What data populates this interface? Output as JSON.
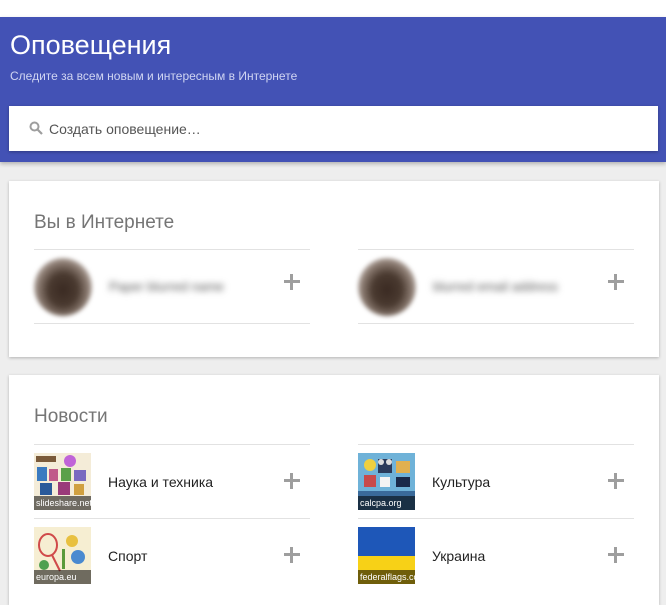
{
  "header": {
    "title": "Оповещения",
    "subtitle": "Следите за всем новым и интересным в Интернете",
    "accent_color": "#4352b5"
  },
  "search": {
    "placeholder": "Создать оповещение…",
    "icon": "search-icon"
  },
  "you_on_web": {
    "title": "Вы в Интернете",
    "items": [
      {
        "avatar": "avatar",
        "name": "Paper blurred name",
        "action_icon": "plus-icon"
      },
      {
        "avatar": "avatar",
        "name": "blurred email address",
        "action_icon": "plus-icon"
      }
    ]
  },
  "news": {
    "title": "Новости",
    "items": [
      {
        "label": "Наука и техника",
        "source": "slideshare.net",
        "action_icon": "plus-icon"
      },
      {
        "label": "Культура",
        "source": "calcpa.org",
        "action_icon": "plus-icon"
      },
      {
        "label": "Спорт",
        "source": "europa.eu",
        "action_icon": "plus-icon"
      },
      {
        "label": "Украина",
        "source": "federalflags.com",
        "action_icon": "plus-icon"
      }
    ]
  }
}
